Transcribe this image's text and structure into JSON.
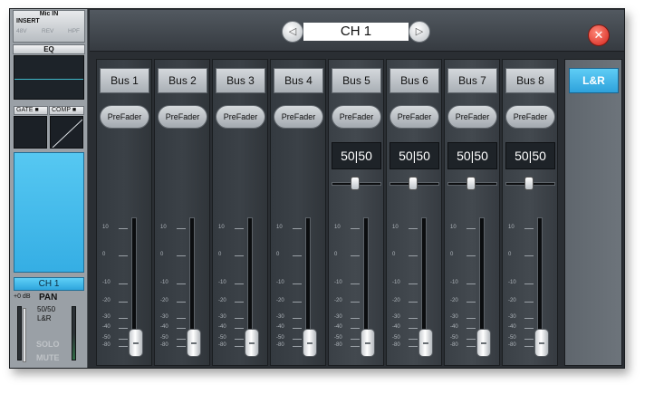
{
  "left_strip": {
    "input": "Mic IN",
    "insert": "INSERT",
    "fx": [
      "48V",
      "REV",
      "HPF"
    ],
    "eq_label": "EQ",
    "gate_label": "GATE",
    "comp_label": "COMP",
    "channel_label": "CH 1",
    "gain_db": "+0 dB",
    "pan_label": "PAN",
    "pan_value": "50/50",
    "output": "L&R",
    "solo_label": "SOLO",
    "mute_label": "MUTE"
  },
  "header": {
    "prev_arrow": "◁",
    "channel_name": "CH 1",
    "next_arrow": "▷",
    "close_symbol": "✕"
  },
  "fader_scale": [
    "10",
    "0",
    "-10",
    "-20",
    "-30",
    "-40",
    "-50",
    "-80"
  ],
  "buses": [
    {
      "label": "Bus 1",
      "tap": "PreFader",
      "pan": ""
    },
    {
      "label": "Bus 2",
      "tap": "PreFader",
      "pan": ""
    },
    {
      "label": "Bus 3",
      "tap": "PreFader",
      "pan": ""
    },
    {
      "label": "Bus 4",
      "tap": "PreFader",
      "pan": ""
    },
    {
      "label": "Bus 5",
      "tap": "PreFader",
      "pan": "50|50"
    },
    {
      "label": "Bus 6",
      "tap": "PreFader",
      "pan": "50|50"
    },
    {
      "label": "Bus 7",
      "tap": "PreFader",
      "pan": "50|50"
    },
    {
      "label": "Bus 8",
      "tap": "PreFader",
      "pan": "50|50"
    }
  ],
  "lr_label": "L&R",
  "colors": {
    "accent_blue": "#35aee4",
    "close_red": "#d4221a",
    "panel_dark": "#2a2e33"
  }
}
